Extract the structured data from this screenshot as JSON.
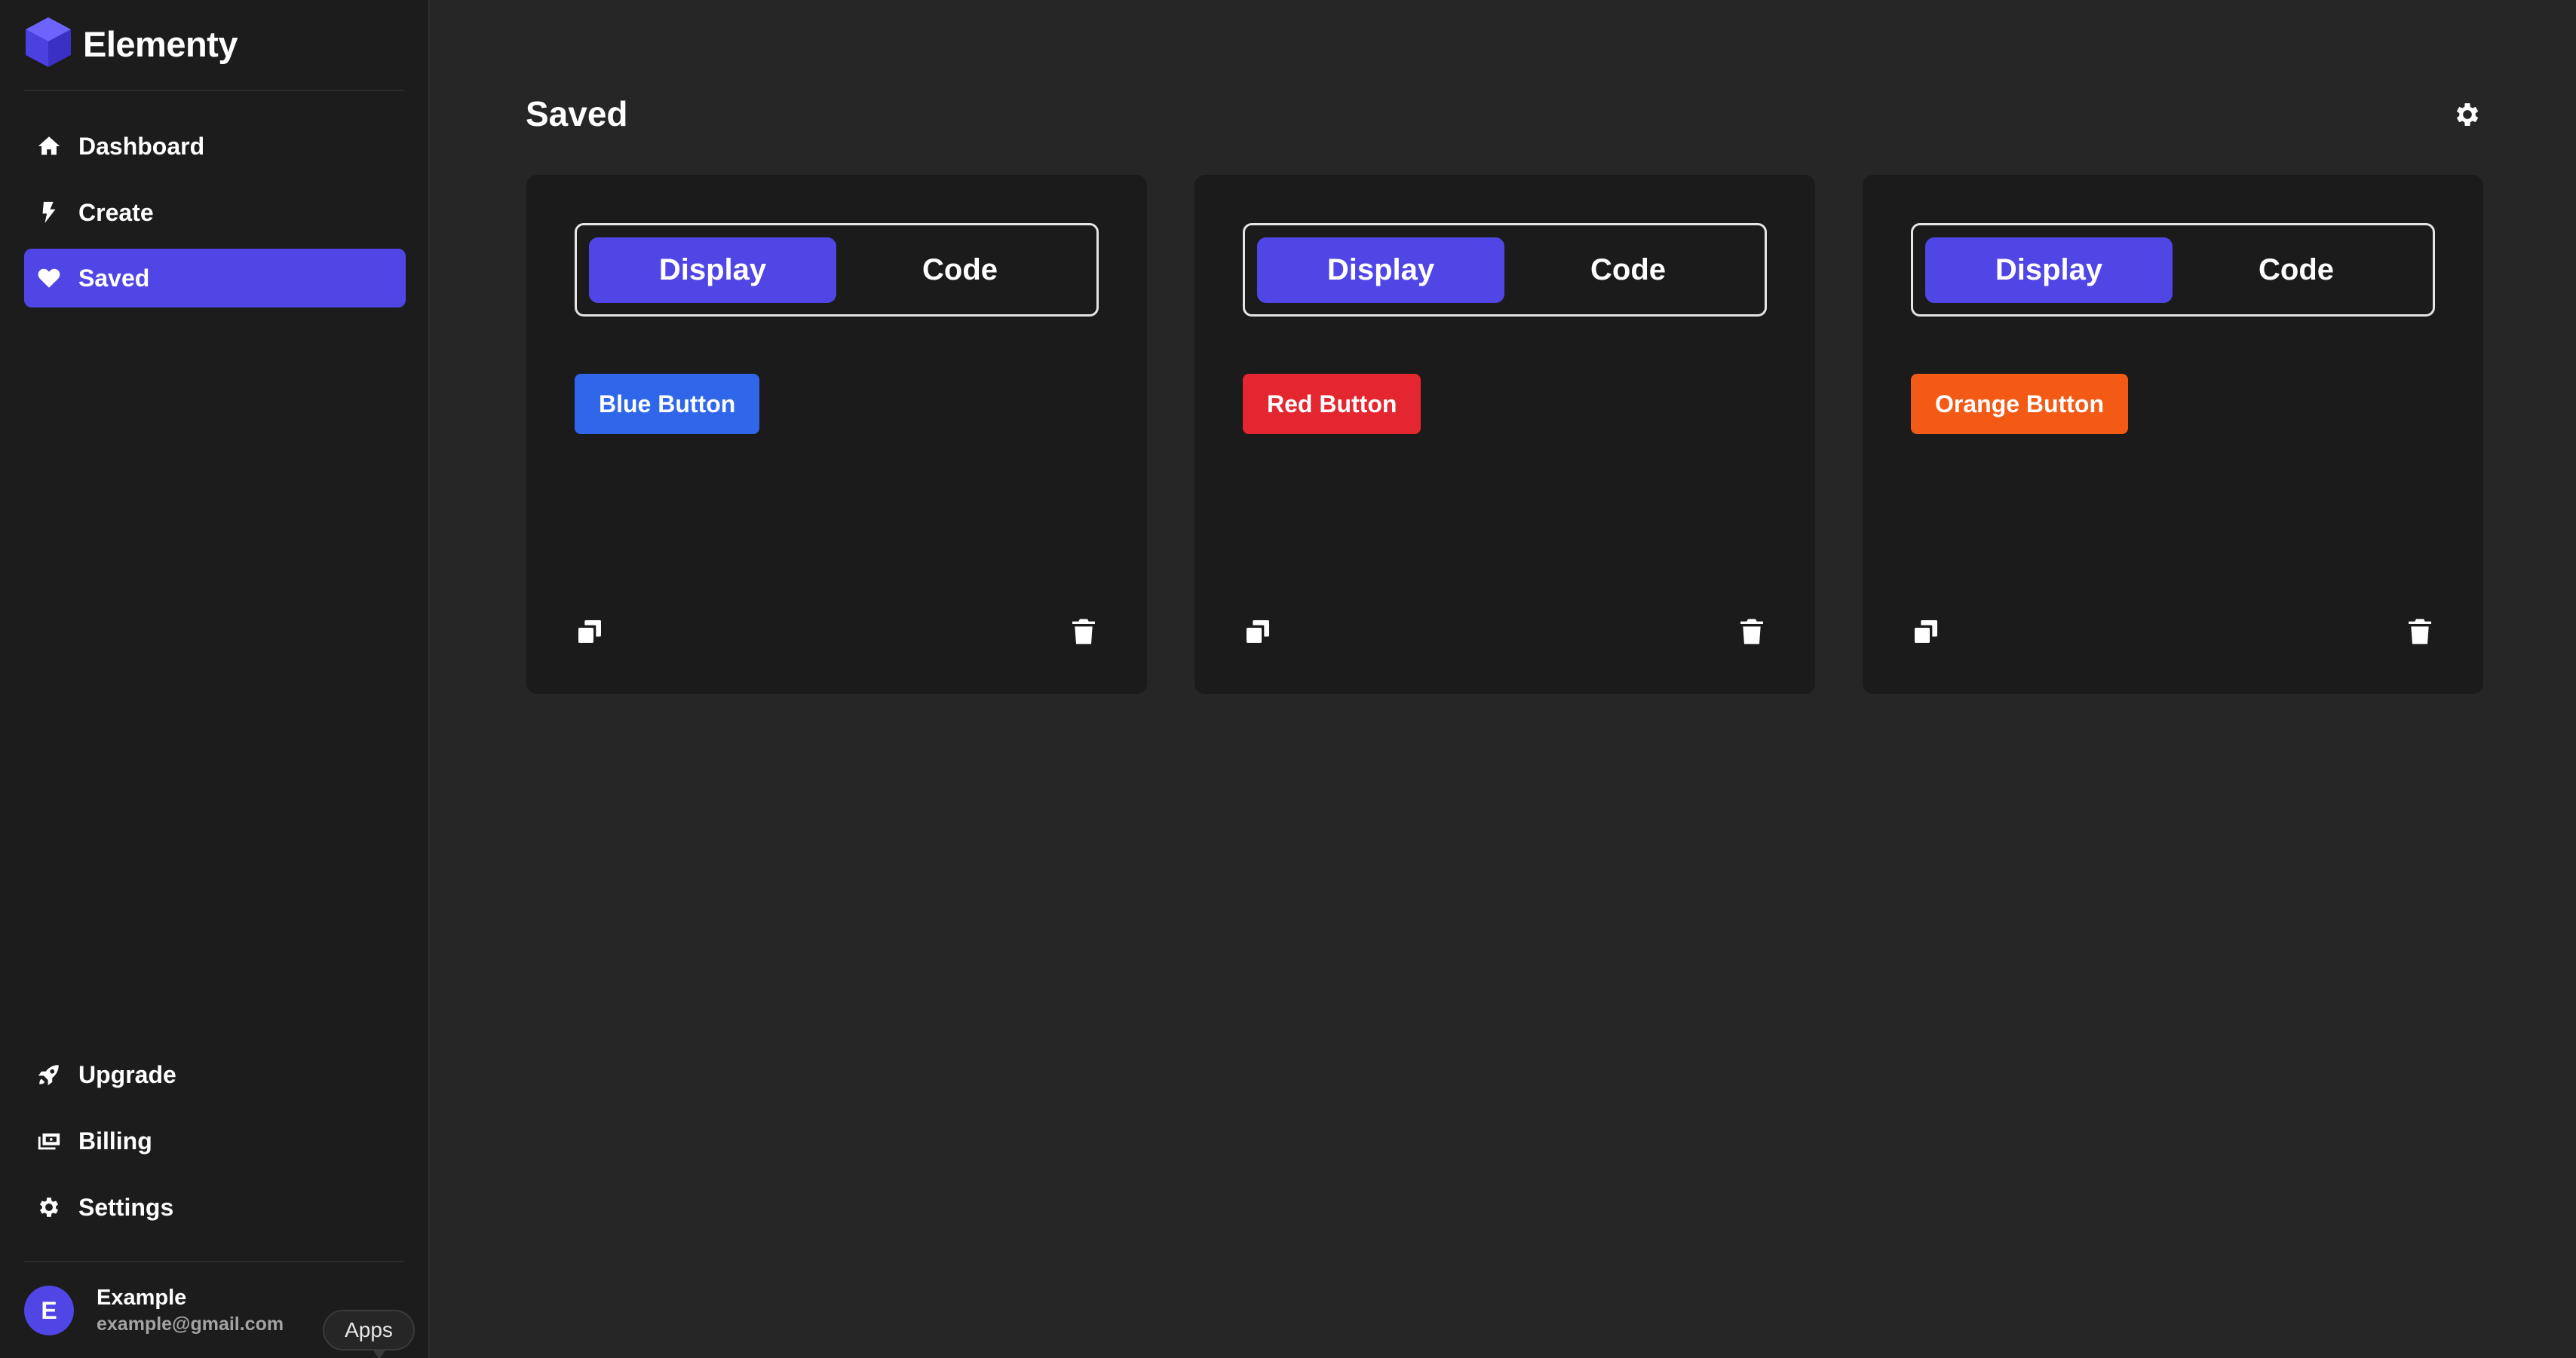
{
  "app": {
    "name": "Elementy",
    "brand_color": "#5046e5"
  },
  "sidebar": {
    "top_items": [
      {
        "label": "Dashboard",
        "icon": "home-icon",
        "active": false
      },
      {
        "label": "Create",
        "icon": "bolt-icon",
        "active": false
      },
      {
        "label": "Saved",
        "icon": "heart-icon",
        "active": true
      }
    ],
    "bottom_items": [
      {
        "label": "Upgrade",
        "icon": "rocket-icon"
      },
      {
        "label": "Billing",
        "icon": "money-icon"
      },
      {
        "label": "Settings",
        "icon": "gear-icon"
      }
    ],
    "user": {
      "initial": "E",
      "name": "Example",
      "email": "example@gmail.com"
    },
    "apps_label": "Apps"
  },
  "main": {
    "title": "Saved",
    "cards": [
      {
        "tab_display": "Display",
        "tab_code": "Code",
        "active_tab": "Display",
        "preview_label": "Blue Button",
        "preview_color": "#2f66ea"
      },
      {
        "tab_display": "Display",
        "tab_code": "Code",
        "active_tab": "Display",
        "preview_label": "Red Button",
        "preview_color": "#e3262f"
      },
      {
        "tab_display": "Display",
        "tab_code": "Code",
        "active_tab": "Display",
        "preview_label": "Orange Button",
        "preview_color": "#f25a16"
      }
    ]
  }
}
